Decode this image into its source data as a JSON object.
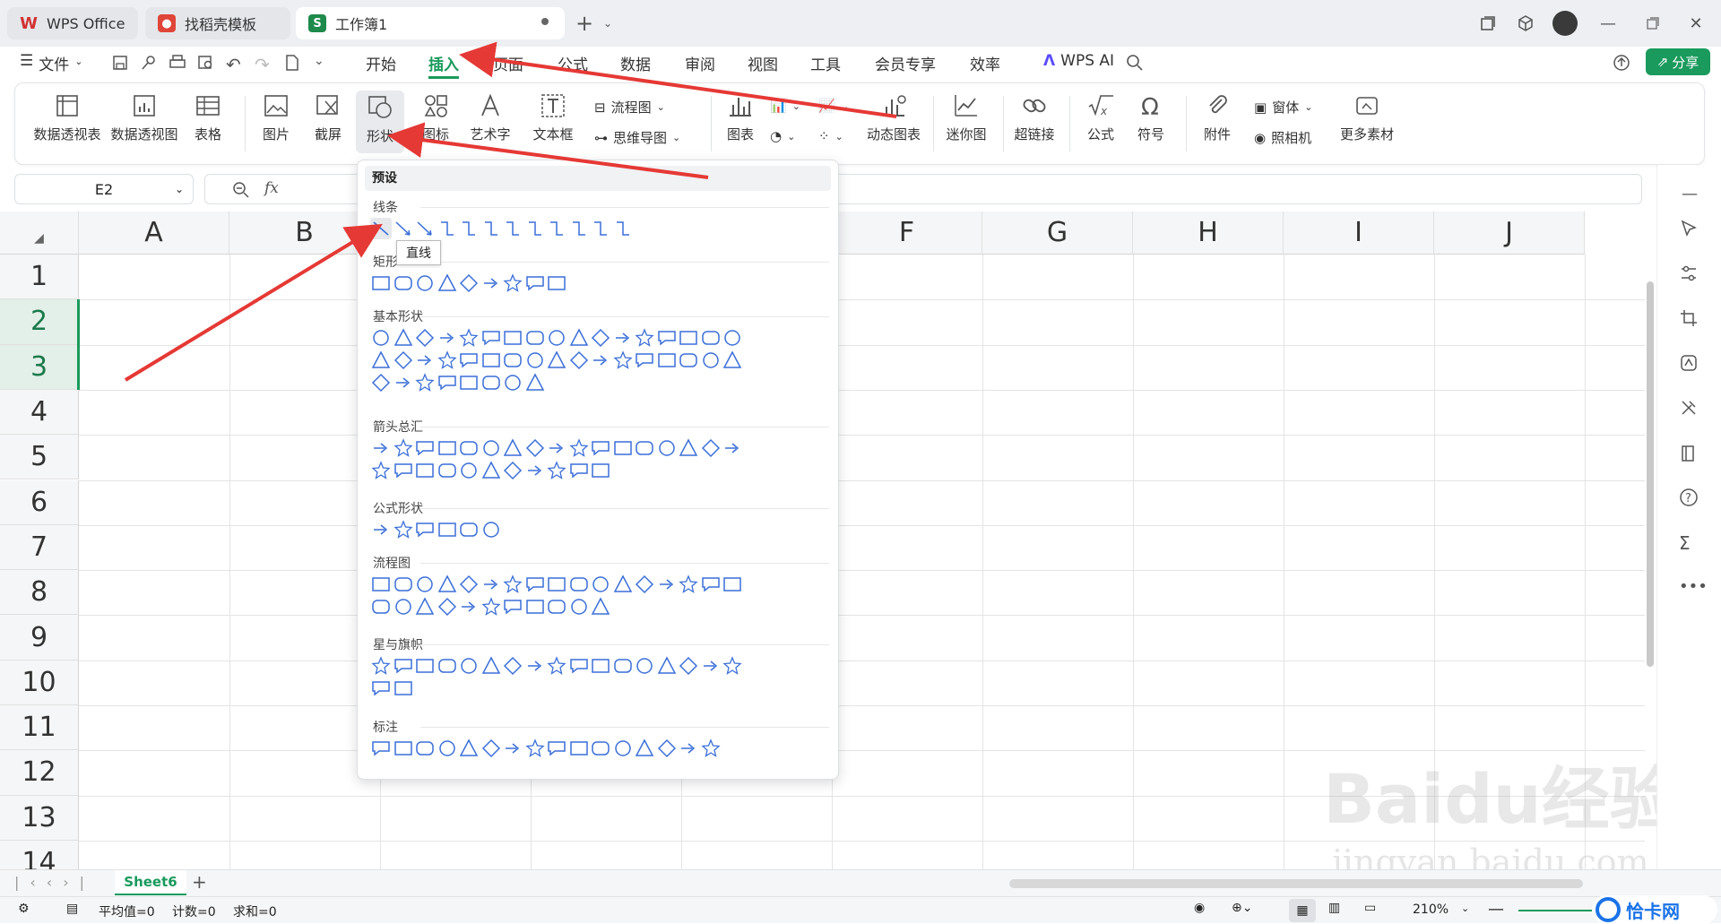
{
  "tabs": [
    {
      "label": "WPS Office",
      "color": "#d23232"
    },
    {
      "label": "找稻壳模板",
      "color": "#e0453a"
    },
    {
      "label": "工作簿1",
      "color": "#1e8a4b"
    }
  ],
  "file_menu": "文件",
  "menus": [
    "开始",
    "插入",
    "页面",
    "公式",
    "数据",
    "审阅",
    "视图",
    "工具",
    "会员专享",
    "效率"
  ],
  "active_menu": "插入",
  "wps_ai": "WPS AI",
  "share": "分享",
  "ribbon": {
    "big": [
      "数据透视表",
      "数据透视图",
      "表格",
      "图片",
      "截屏",
      "形状",
      "图标",
      "艺术字",
      "文本框",
      "图表",
      "动态图表",
      "迷你图",
      "超链接",
      "公式",
      "符号",
      "附件",
      "照相机",
      "更多素材"
    ],
    "small": [
      "流程图",
      "思维导图",
      "窗体"
    ]
  },
  "namebox": "E2",
  "fx": "fx",
  "columns": [
    "A",
    "B",
    "C",
    "D",
    "E",
    "F",
    "G",
    "H",
    "I",
    "J"
  ],
  "rows": [
    "1",
    "2",
    "3",
    "4",
    "5",
    "6",
    "7",
    "8",
    "9",
    "10",
    "11",
    "12",
    "13",
    "14"
  ],
  "dropdown": {
    "header": "预设",
    "sections": [
      {
        "title": "线条",
        "count": 12
      },
      {
        "title": "矩形",
        "count": 9
      },
      {
        "title": "基本形状",
        "count": 42
      },
      {
        "title": "箭头总汇",
        "count": 28
      },
      {
        "title": "公式形状",
        "count": 6
      },
      {
        "title": "流程图",
        "count": 28
      },
      {
        "title": "星与旗帜",
        "count": 19
      },
      {
        "title": "标注",
        "count": 16
      }
    ]
  },
  "tooltip": "直线",
  "sheet": "Sheet6",
  "status": {
    "avg": "平均值=0",
    "count": "计数=0",
    "sum": "求和=0",
    "zoom": "210%"
  },
  "watermark": {
    "brand": "Baidu经验",
    "url": "jingyan.baidu.com",
    "logo": "恰卡网"
  },
  "colors": {
    "accent": "#1a9a5c",
    "arrow": "#e53935",
    "shape": "#3a6fd8"
  }
}
